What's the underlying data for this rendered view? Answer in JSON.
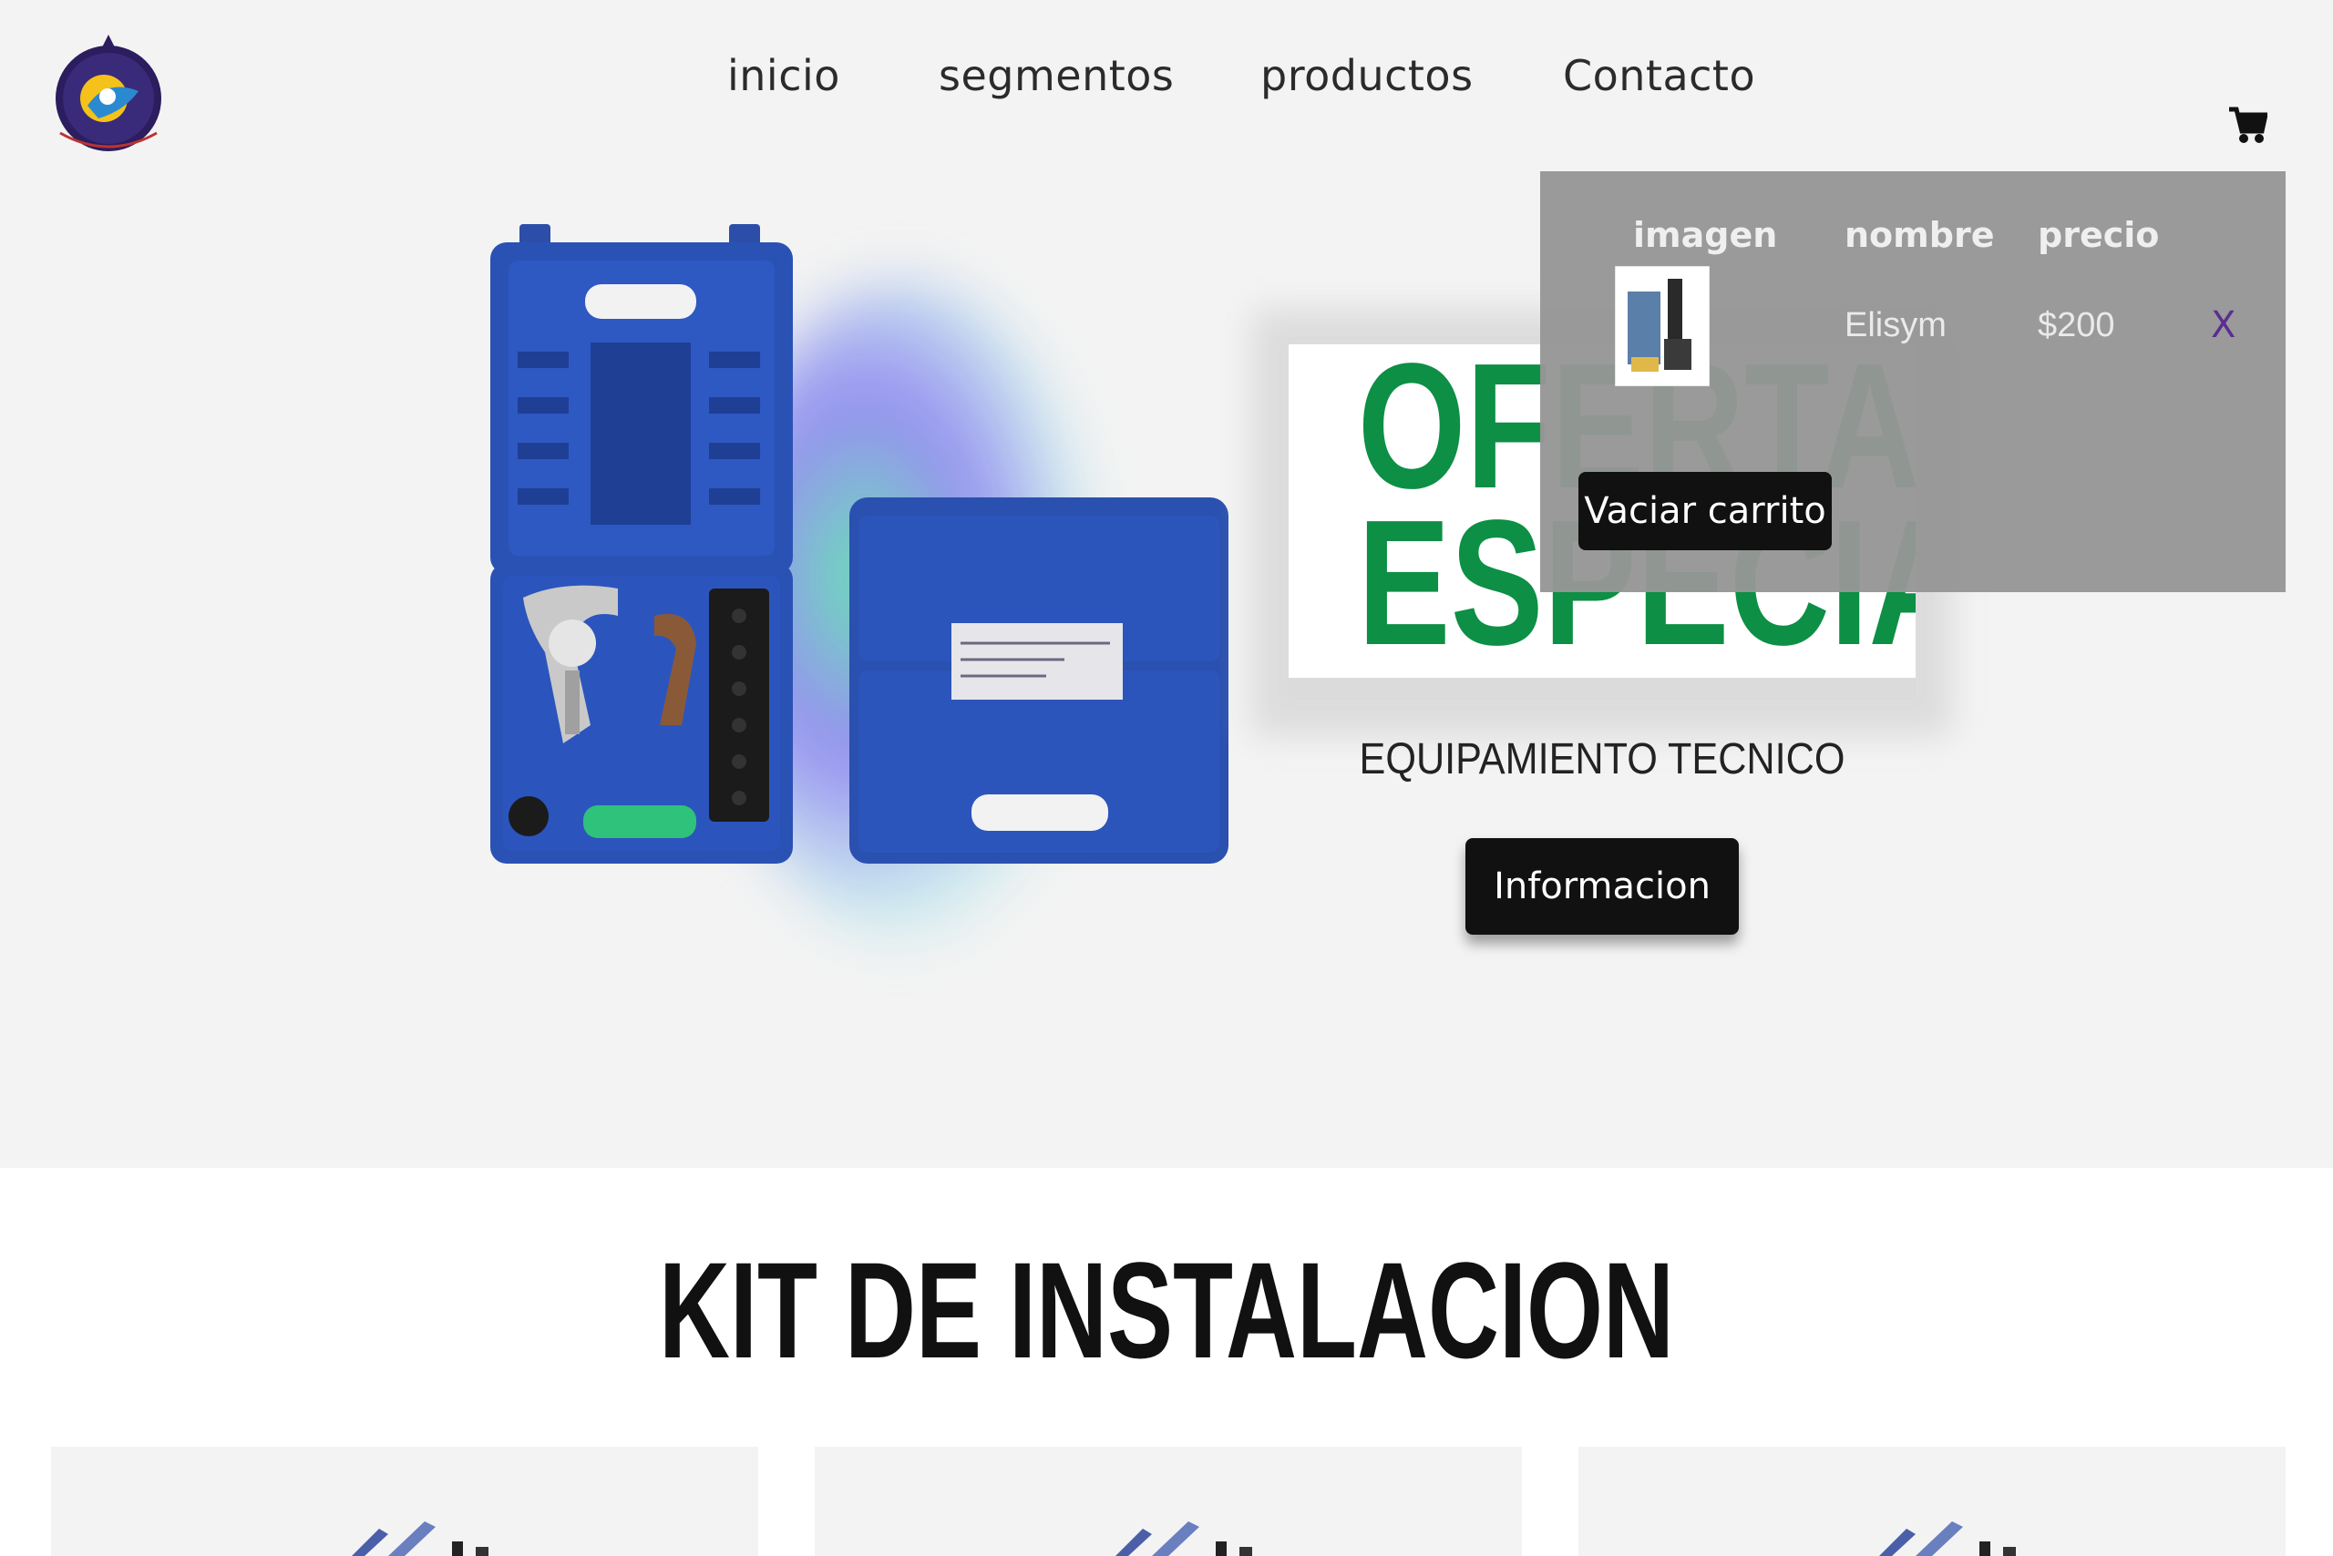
{
  "header": {
    "logo_name": "brand-logo",
    "nav": [
      "inicio",
      "segmentos",
      "productos",
      "Contacto"
    ],
    "cart_icon": "cart-icon"
  },
  "hero": {
    "promo_line1": "OFERTAS",
    "promo_line2": "ESPECIALES",
    "subtitle": "EQUIPAMIENTO TECNICO",
    "button": "Informacion",
    "image": "flaring-tool-kit-image"
  },
  "cart": {
    "headers": [
      "imagen",
      "nombre",
      "precio"
    ],
    "items": [
      {
        "nombre": "Elisym",
        "precio": "$200",
        "remove": "X"
      }
    ],
    "empty_button": "Vaciar carrito"
  },
  "section": {
    "title": "KIT DE INSTALACION"
  },
  "colors": {
    "accent_green": "#0d8f45",
    "button_black": "#111111",
    "hero_bg": "#f3f3f3",
    "cart_panel": "#969696",
    "remove_x": "#5b2d91"
  }
}
